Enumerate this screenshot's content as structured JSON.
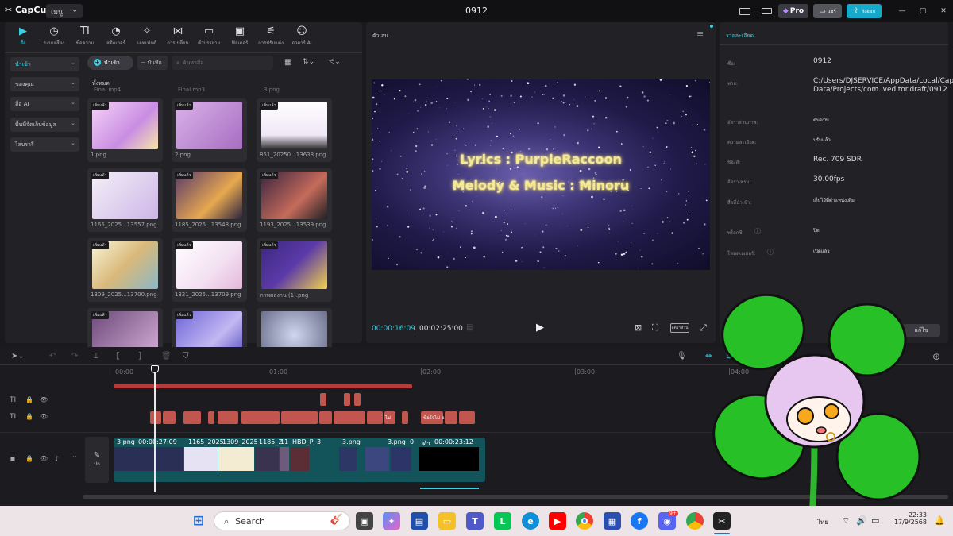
{
  "app": {
    "name": "CapCut",
    "menu_label": "เมนู",
    "project_title": "0912",
    "pro_label": "Pro",
    "share_label": "แชร์",
    "export_label": "ส่งออก"
  },
  "toolbar": {
    "tools": [
      {
        "label": "สื่อ",
        "icon": "media-icon"
      },
      {
        "label": "ระบบเสียง",
        "icon": "audio-icon"
      },
      {
        "label": "ข้อความ",
        "icon": "text-icon",
        "glyph": "TI"
      },
      {
        "label": "สติกเกอร์",
        "icon": "sticker-icon"
      },
      {
        "label": "เอฟเฟกต์",
        "icon": "effects-icon"
      },
      {
        "label": "การเปลี่ยน",
        "icon": "transition-icon"
      },
      {
        "label": "คำบรรยาย",
        "icon": "captions-icon"
      },
      {
        "label": "ฟิลเตอร์",
        "icon": "filter-icon"
      },
      {
        "label": "การปรับแต่ง",
        "icon": "adjust-icon"
      },
      {
        "label": "อวตาร์ AI",
        "icon": "ai-avatar-icon"
      }
    ]
  },
  "sidebar": {
    "items": [
      {
        "label": "นำเข้า",
        "active": true
      },
      {
        "label": "ของคุณ"
      },
      {
        "label": "สื่อ AI"
      },
      {
        "label": "พื้นที่จัดเก็บข้อมูล"
      },
      {
        "label": "ไลบรารี"
      }
    ]
  },
  "media_toolbar": {
    "import_label": "นำเข้า",
    "record_label": "บันทึก",
    "search_placeholder": "ค้นหาสื่อ"
  },
  "media": {
    "section_label": "ทั้งหมด",
    "partial_labels": [
      "Final.mp4",
      "Final.mp3",
      "3.png"
    ],
    "added_badge": "เพิ่มแล้ว",
    "items": [
      {
        "name": "1.png"
      },
      {
        "name": "2.png"
      },
      {
        "name": "851_20250...13638.png"
      },
      {
        "name": "1165_2025...13557.png"
      },
      {
        "name": "1185_2025...13548.png"
      },
      {
        "name": "1193_2025...13539.png"
      },
      {
        "name": "1309_2025...13700.png"
      },
      {
        "name": "1321_2025...13709.png"
      },
      {
        "name": "ภาพผลงาน (1).png"
      },
      {
        "name": ""
      },
      {
        "name": ""
      },
      {
        "name": ""
      }
    ]
  },
  "player": {
    "title": "ตัวเล่น",
    "lyric_1": "Lyrics : PurpleRaccoon",
    "lyric_2": "Melody & Music : Minoru",
    "current_time": "00:00:16:09",
    "total_time": "00:02:25:00",
    "ratio_label": "อัตราส่วน"
  },
  "details": {
    "title": "รายละเอียด",
    "rows": [
      {
        "key": "ชื่อ:",
        "value": "0912"
      },
      {
        "key": "พาธ:",
        "value": "C:/Users/DJSERVICE/AppData/Local/CapCut/User Data/Projects/com.lveditor.draft/0912"
      },
      {
        "key": "อัตราส่วนภาพ:",
        "value": "ต้นฉบับ"
      },
      {
        "key": "ความละเอียด:",
        "value": "ปรับแล้ว"
      },
      {
        "key": "ช่องสี:",
        "value": "Rec. 709 SDR"
      },
      {
        "key": "อัตราเฟรม:",
        "value": "30.00fps"
      },
      {
        "key": "สื่อที่นำเข้า:",
        "value": "เก็บไว้ที่ตำแหน่งเดิม"
      },
      {
        "key": "พร็อกซี:",
        "value": "ปิด"
      },
      {
        "key": "โหมดเลเยอร์:",
        "value": "เปิดแล้ว"
      }
    ],
    "modify_button": "แก้ไข"
  },
  "timeline": {
    "ruler": [
      "00:00",
      "01:00",
      "02:00",
      "03:00",
      "04:00"
    ],
    "cover_label": "ปก",
    "clip_labels": [
      {
        "text": "3.png"
      },
      {
        "text": "00:00:27:09"
      },
      {
        "text": "1165_2025"
      },
      {
        "text": "1309_2025"
      },
      {
        "text": "1185_2"
      },
      {
        "text": "11"
      },
      {
        "text": "HBD_Pj"
      },
      {
        "text": "3."
      },
      {
        "text": "3.png"
      },
      {
        "text": "3.png"
      },
      {
        "text": "0"
      },
      {
        "text": "ดำ"
      },
      {
        "text": "00:00:23:12"
      }
    ],
    "text_clip_labels": [
      "ไม่",
      " ข้อใจไม่ อ"
    ]
  },
  "taskbar": {
    "search_placeholder": "Search",
    "clock_time": "22:33",
    "clock_date": "17/9/2568",
    "lang": "ไทย",
    "discord_badge": "9+"
  }
}
